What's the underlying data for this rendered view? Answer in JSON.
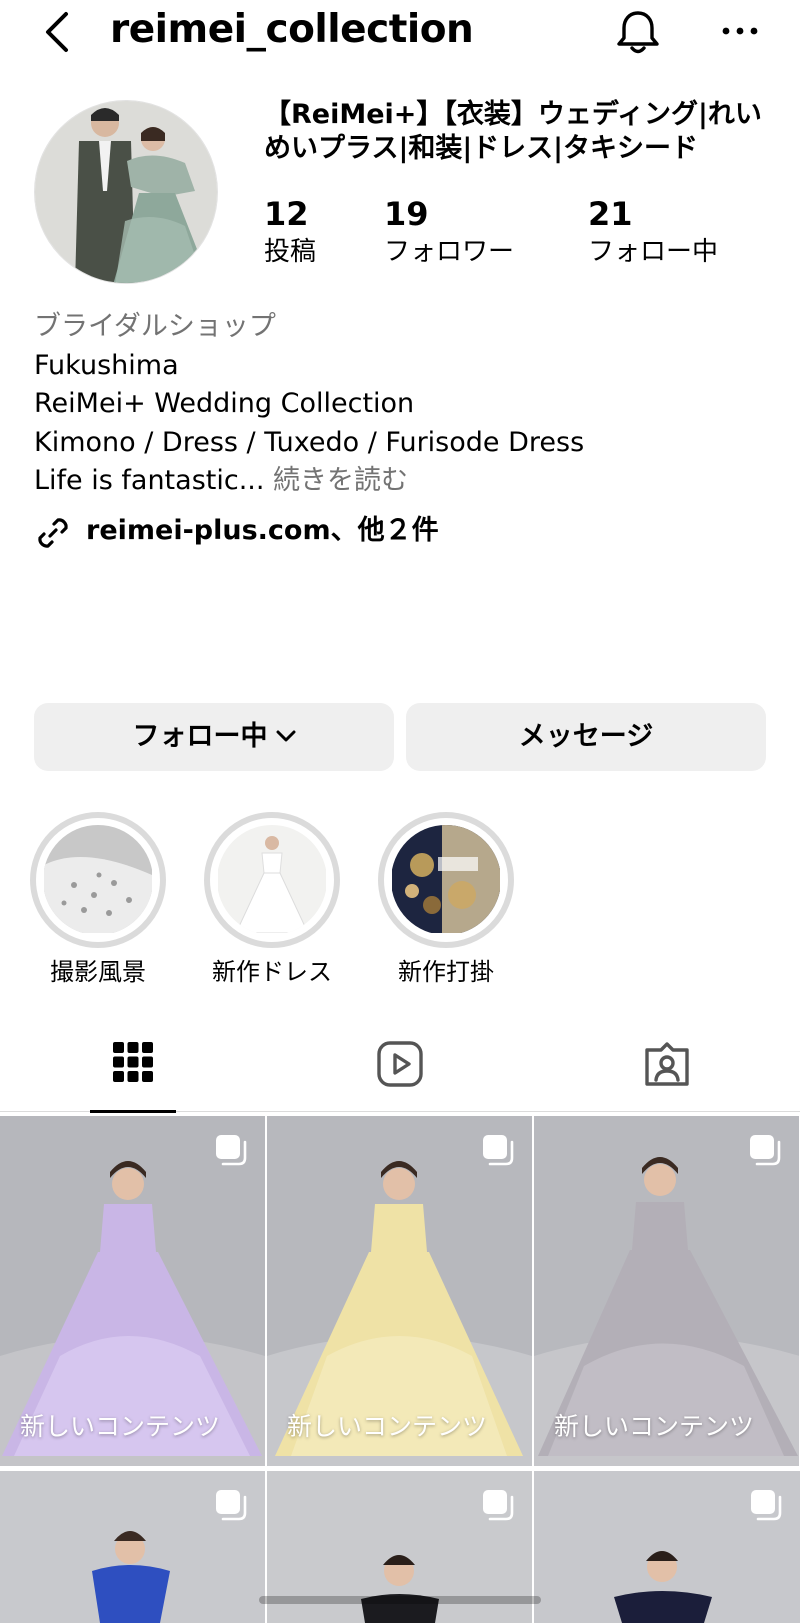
{
  "header": {
    "username": "reimei_collection",
    "back_icon": "chevron-left-icon",
    "bell_icon": "bell-icon",
    "more_icon": "ellipsis-icon"
  },
  "profile": {
    "display_name": "【ReiMei+】【衣装】ウェディング|れいめいプラス|和装|ドレス|タキシード",
    "stats": [
      {
        "value": "12",
        "label": "投稿"
      },
      {
        "value": "19",
        "label": "フォロワー"
      },
      {
        "value": "21",
        "label": "フォロー中"
      }
    ],
    "category": "ブライダルショップ",
    "bio_lines": [
      "Fukushima",
      "ReiMei+ Wedding Collection",
      "Kimono / Dress / Tuxedo / Furisode Dress"
    ],
    "bio_last": "Life is fantastic...",
    "read_more": "続きを読む",
    "link_text": "reimei-plus.com、他２件"
  },
  "buttons": {
    "following": "フォロー中",
    "message": "メッセージ"
  },
  "highlights": [
    {
      "label": "撮影風景"
    },
    {
      "label": "新作ドレス"
    },
    {
      "label": "新作打掛"
    }
  ],
  "tabs": [
    "grid-icon",
    "reels-icon",
    "tagged-icon"
  ],
  "posts": [
    {
      "label": "新しいコンテンツ",
      "dress_color": "#c9b6e6"
    },
    {
      "label": "新しいコンテンツ",
      "dress_color": "#efe2a6"
    },
    {
      "label": "新しいコンテンツ",
      "dress_color": "#b3afb7"
    },
    {
      "label": "",
      "dress_color": "#2e4fc0"
    },
    {
      "label": "",
      "dress_color": "#1b1b1f"
    },
    {
      "label": "",
      "dress_color": "#1b1e3a"
    }
  ],
  "colors": {
    "button_bg": "#efefef",
    "secondary_text": "#737373",
    "ring": "#dbdbdb"
  }
}
